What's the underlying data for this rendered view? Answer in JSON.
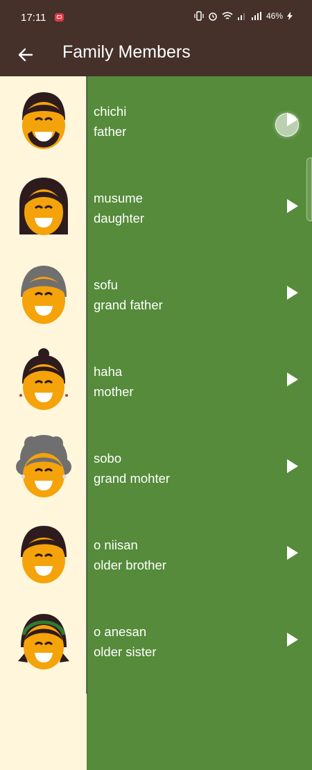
{
  "status_bar": {
    "time": "17:11",
    "battery": "46%"
  },
  "app_bar": {
    "title": "Family Members",
    "back_icon": "arrow-left-icon"
  },
  "colors": {
    "app_bar": "#45302a",
    "row_background": "#558b3a",
    "avatar_background": "#fff6dc",
    "skin": "#f5a30a"
  },
  "members": [
    {
      "japanese": "chichi",
      "english": "father",
      "avatar": "father-avatar"
    },
    {
      "japanese": "musume",
      "english": "daughter",
      "avatar": "daughter-avatar"
    },
    {
      "japanese": "sofu",
      "english": "grand father",
      "avatar": "grandfather-avatar"
    },
    {
      "japanese": "haha",
      "english": "mother",
      "avatar": "mother-avatar"
    },
    {
      "japanese": "sobo",
      "english": "grand mohter",
      "avatar": "grandmother-avatar"
    },
    {
      "japanese": "o niisan",
      "english": "older brother",
      "avatar": "older-brother-avatar"
    },
    {
      "japanese": "o anesan",
      "english": "older sister",
      "avatar": "older-sister-avatar"
    }
  ]
}
